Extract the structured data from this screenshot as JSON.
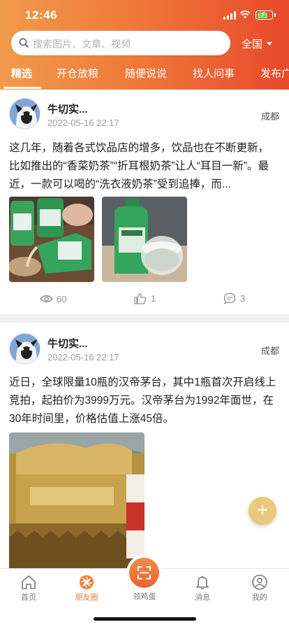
{
  "status": {
    "time": "12:46"
  },
  "search": {
    "placeholder": "搜索图片、文章、视频"
  },
  "region": {
    "label": "全国"
  },
  "tabs": [
    {
      "label": "精选",
      "active": true
    },
    {
      "label": "开仓放粮"
    },
    {
      "label": "随便说说"
    },
    {
      "label": "找人问事"
    },
    {
      "label": "发布广"
    }
  ],
  "posts": [
    {
      "author": "牛切实...",
      "date": "2022-05-16 22:17",
      "city": "成都",
      "text": "这几年，随着各式饮品店的增多，饮品也在不断更新，比如推出的“香菜奶茶”“折耳根奶茶”让人“耳目一新”。最近，一款可以喝的“洗衣液奶茶”受到追捧，而...",
      "views": "60",
      "likes": "1",
      "comments": "3"
    },
    {
      "author": "牛切实...",
      "date": "2022-05-16 22:17",
      "city": "成都",
      "text": "近日，全球限量10瓶的汉帝茅台，其中1瓶首次开启线上竞拍，起拍价为3999万元。汉帝茅台为1992年面世，在30年时间里，价格估值上涨45倍。"
    }
  ],
  "fab": {
    "label": "+"
  },
  "tabbar": {
    "items": [
      {
        "label": "首页",
        "icon": "home-icon"
      },
      {
        "label": "朋友圈",
        "icon": "aperture-icon",
        "active": true
      },
      {
        "label": "领鸡蛋",
        "icon": "scan-icon"
      },
      {
        "label": "消息",
        "icon": "bell-icon"
      },
      {
        "label": "我的",
        "icon": "user-icon"
      }
    ]
  },
  "colors": {
    "accent": "#ee7d35",
    "header_start": "#f19a4c",
    "header_end": "#e8492b",
    "fab": "#edc87a"
  }
}
